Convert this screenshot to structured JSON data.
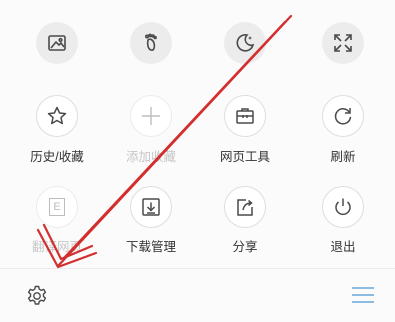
{
  "colors": {
    "icon": "#4a4a4a",
    "icon_disabled": "#bdbdbd",
    "label": "#333333",
    "label_disabled": "#c6c6c6",
    "menu_icon": "#6aa7d8",
    "annotation_arrow": "#d32f2f"
  },
  "quick_actions": [
    {
      "icon": "image-icon"
    },
    {
      "icon": "footprint-icon"
    },
    {
      "icon": "night-mode-icon"
    },
    {
      "icon": "fullscreen-icon"
    }
  ],
  "menu": {
    "row1": [
      {
        "label": "历史/收藏",
        "icon": "star-icon",
        "enabled": true
      },
      {
        "label": "添加收藏",
        "icon": "plus-icon",
        "enabled": false
      },
      {
        "label": "网页工具",
        "icon": "toolbox-icon",
        "enabled": true
      },
      {
        "label": "刷新",
        "icon": "refresh-icon",
        "enabled": true
      }
    ],
    "row2": [
      {
        "label": "翻译网页",
        "icon": "translate-icon",
        "enabled": false
      },
      {
        "label": "下载管理",
        "icon": "download-icon",
        "enabled": true
      },
      {
        "label": "分享",
        "icon": "share-icon",
        "enabled": true
      },
      {
        "label": "退出",
        "icon": "power-icon",
        "enabled": true
      }
    ],
    "translate_glyph": "E"
  },
  "bottom_bar": {
    "settings_icon": "gear-icon",
    "menu_icon": "hamburger-menu-icon"
  }
}
